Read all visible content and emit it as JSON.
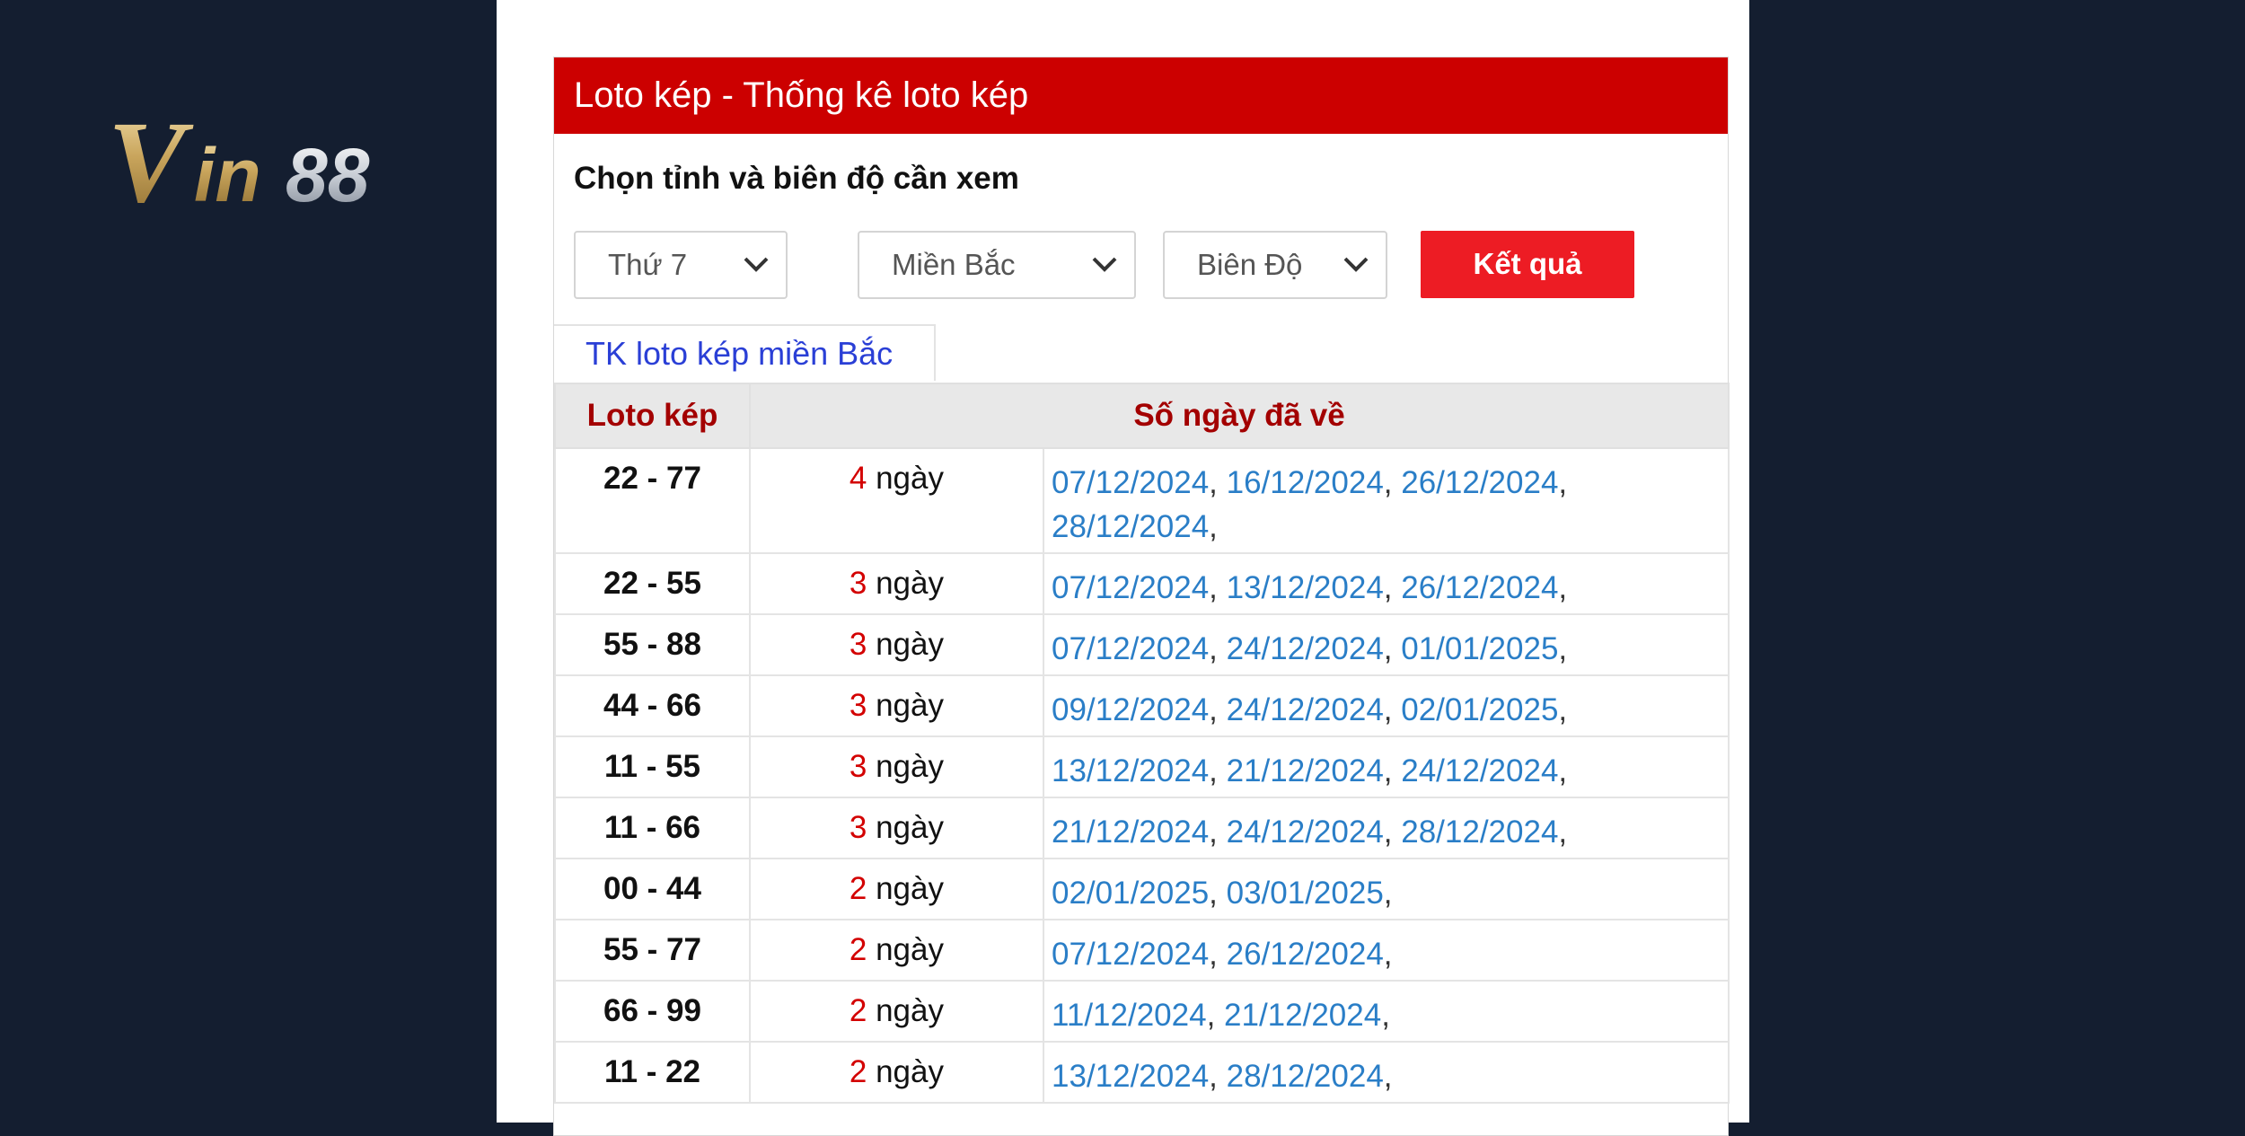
{
  "brand": {
    "logo_text": "Vin88"
  },
  "header": {
    "title": "Loto kép - Thống kê loto kép"
  },
  "filter": {
    "prompt": "Chọn tỉnh và biên độ cần xem",
    "day_select": "Thứ 7",
    "region_select": "Miền Bắc",
    "range_select": "Biên Độ",
    "submit_label": "Kết quả"
  },
  "tab": {
    "label": "TK loto kép miền Bắc"
  },
  "table": {
    "headers": {
      "col1": "Loto kép",
      "col2": "Số ngày đã về"
    },
    "days_unit": "ngày",
    "rows": [
      {
        "pair": "22 - 77",
        "count": "4",
        "dates": [
          "07/12/2024",
          "16/12/2024",
          "26/12/2024",
          "28/12/2024"
        ]
      },
      {
        "pair": "22 - 55",
        "count": "3",
        "dates": [
          "07/12/2024",
          "13/12/2024",
          "26/12/2024"
        ]
      },
      {
        "pair": "55 - 88",
        "count": "3",
        "dates": [
          "07/12/2024",
          "24/12/2024",
          "01/01/2025"
        ]
      },
      {
        "pair": "44 - 66",
        "count": "3",
        "dates": [
          "09/12/2024",
          "24/12/2024",
          "02/01/2025"
        ]
      },
      {
        "pair": "11 - 55",
        "count": "3",
        "dates": [
          "13/12/2024",
          "21/12/2024",
          "24/12/2024"
        ]
      },
      {
        "pair": "11 - 66",
        "count": "3",
        "dates": [
          "21/12/2024",
          "24/12/2024",
          "28/12/2024"
        ]
      },
      {
        "pair": "00 - 44",
        "count": "2",
        "dates": [
          "02/01/2025",
          "03/01/2025"
        ]
      },
      {
        "pair": "55 - 77",
        "count": "2",
        "dates": [
          "07/12/2024",
          "26/12/2024"
        ]
      },
      {
        "pair": "66 - 99",
        "count": "2",
        "dates": [
          "11/12/2024",
          "21/12/2024"
        ]
      },
      {
        "pair": "11 - 22",
        "count": "2",
        "dates": [
          "13/12/2024",
          "28/12/2024"
        ]
      }
    ]
  },
  "colors": {
    "header_red": "#cc0000",
    "button_red": "#ed1c24",
    "date_blue": "#2a7ec7",
    "count_red": "#d30000",
    "page_bg": "#141e30"
  },
  "icons": {
    "select_arrow": "chevron-down-icon"
  }
}
